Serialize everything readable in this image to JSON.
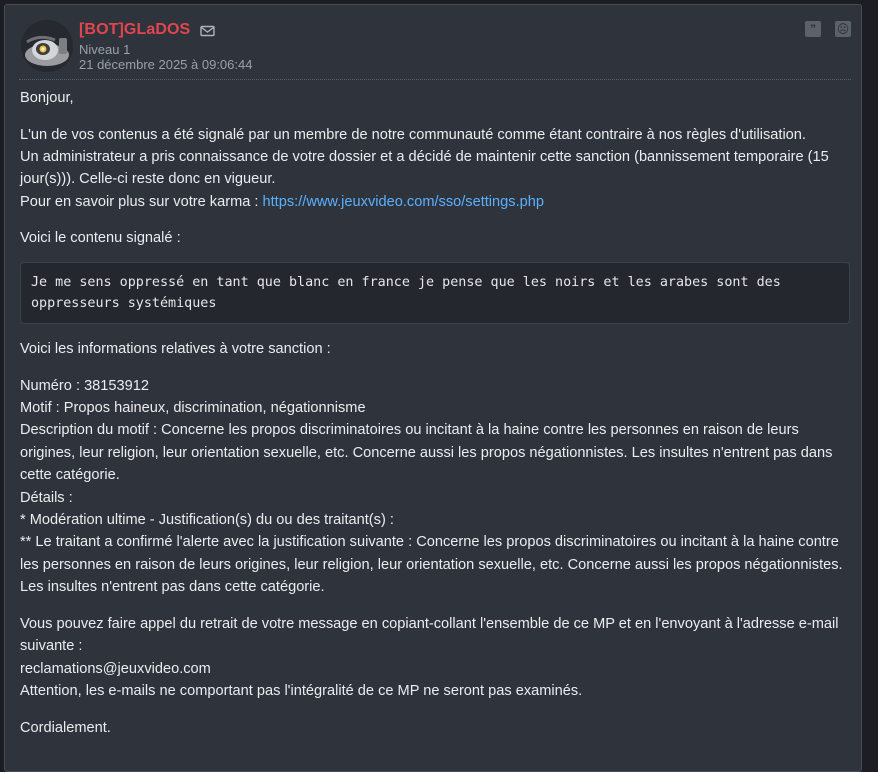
{
  "post": {
    "author": {
      "name": "[BOT]GLaDOS",
      "level": "Niveau 1",
      "date": "21 décembre 2025 à 09:06:44"
    },
    "icons": {
      "avatar": "bot-avatar",
      "mail": "mail-icon",
      "quote_button": "quote-icon",
      "report_button": "report-icon"
    },
    "actions": {
      "quote_glyph": "”",
      "report_glyph": "☹"
    },
    "colors": {
      "author_name": "#e0464f",
      "link": "#5ab0ff",
      "background": "#2f343c"
    },
    "body": {
      "greeting": "Bonjour,",
      "p1_line1": "L'un de vos contenus a été signalé par un membre de notre communauté comme étant contraire à nos règles d'utilisation.",
      "p1_line2": "Un administrateur a pris connaissance de votre dossier et a décidé de maintenir cette sanction (bannissement temporaire (15 jour(s))). Celle-ci reste donc en vigueur.",
      "karma_prefix": "Pour en savoir plus sur votre karma : ",
      "karma_link": "https://www.jeuxvideo.com/sso/settings.php",
      "reported_intro": "Voici le contenu signalé :",
      "reported_content": "Je me sens oppressé en tant que blanc en france je pense que les noirs et les arabes sont des oppresseurs systémiques",
      "sanction_intro": "Voici les informations relatives à votre sanction :",
      "numero": "Numéro : 38153912",
      "motif": "Motif : Propos haineux, discrimination, négationnisme",
      "description": "Description du motif : Concerne les propos discriminatoires ou incitant à la haine contre les personnes en raison de leurs origines, leur religion, leur orientation sexuelle, etc. Concerne aussi les propos négationnistes. Les insultes n'entrent pas dans cette catégorie.",
      "details": "Détails :",
      "detail1": "* Modération ultime - Justification(s) du ou des traitant(s) :",
      "detail2": "** Le traitant a confirmé l'alerte avec la justification suivante : Concerne les propos discriminatoires ou incitant à la haine contre les personnes en raison de leurs origines, leur religion, leur orientation sexuelle, etc. Concerne aussi les propos négationnistes. Les insultes n'entrent pas dans cette catégorie.",
      "appeal": "Vous pouvez faire appel du retrait de votre message en copiant-collant l'ensemble de ce MP et en l'envoyant à l'adresse e-mail suivante :",
      "appeal_email": "reclamations@jeuxvideo.com",
      "warning": "Attention, les e-mails ne comportant pas l'intégralité de ce MP ne seront pas examinés.",
      "closing": "Cordialement."
    }
  }
}
